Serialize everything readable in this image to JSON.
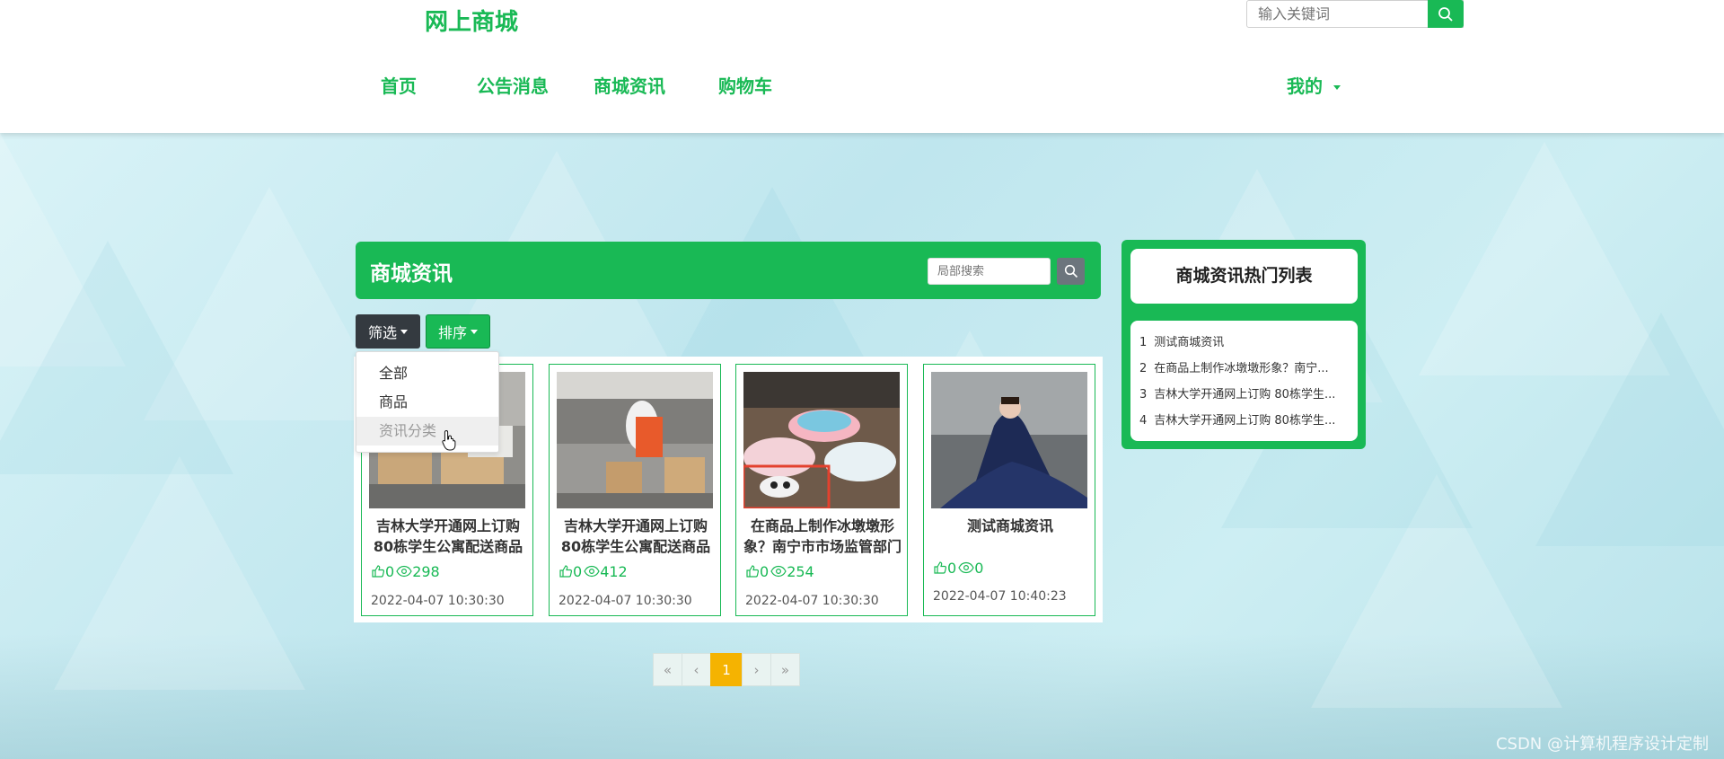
{
  "header": {
    "brand": "网上商城",
    "search_placeholder": "输入关键词",
    "nav": [
      {
        "label": "首页"
      },
      {
        "label": "公告消息"
      },
      {
        "label": "商城资讯"
      },
      {
        "label": "购物车"
      }
    ],
    "user_menu": "我的"
  },
  "panel": {
    "title": "商城资讯",
    "search_placeholder": "局部搜索",
    "filter_label": "筛选",
    "sort_label": "排序",
    "dropdown": [
      "全部",
      "商品",
      "资讯分类"
    ]
  },
  "cards": [
    {
      "title": "吉林大学开通网上订购80栋学生公寓配送商品",
      "likes": "0",
      "views": "298",
      "date": "2022-04-07 10:30:30"
    },
    {
      "title": "吉林大学开通网上订购80栋学生公寓配送商品",
      "likes": "0",
      "views": "412",
      "date": "2022-04-07 10:30:30"
    },
    {
      "title": "在商品上制作冰墩墩形象？南宁市市场监管部门",
      "likes": "0",
      "views": "254",
      "date": "2022-04-07 10:30:30"
    },
    {
      "title": "测试商城资讯",
      "likes": "0",
      "views": "0",
      "date": "2022-04-07 10:40:23"
    }
  ],
  "pagination": {
    "first": "«",
    "prev": "‹",
    "current": "1",
    "next": "›",
    "last": "»"
  },
  "sidebar": {
    "title": "商城资讯热门列表",
    "items": [
      {
        "num": "1",
        "text": "测试商城资讯"
      },
      {
        "num": "2",
        "text": "在商品上制作冰墩墩形象？南宁..."
      },
      {
        "num": "3",
        "text": "吉林大学开通网上订购 80栋学生..."
      },
      {
        "num": "4",
        "text": "吉林大学开通网上订购 80栋学生..."
      }
    ]
  },
  "watermark": "CSDN @计算机程序设计定制",
  "colors": {
    "accent": "#19b955",
    "dark_button": "#343a40",
    "page_active": "#f5b301"
  }
}
